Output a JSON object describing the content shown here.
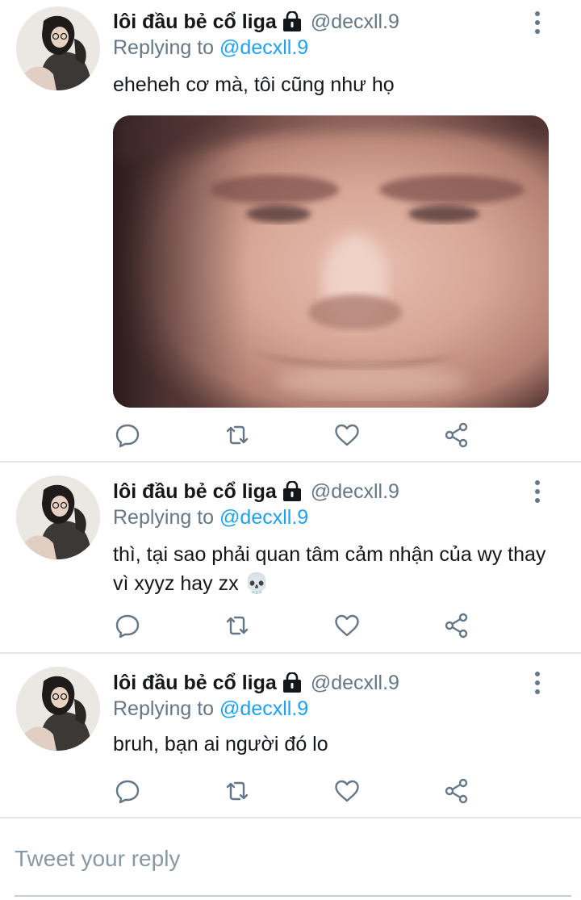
{
  "tweets": [
    {
      "display_name": "lôi đầu bẻ cổ liga",
      "handle": "@decxll.9",
      "replying_prefix": "Replying to",
      "replying_handle": "@decxll.9",
      "text": "eheheh cơ mà, tôi cũng như họ",
      "has_image": true,
      "image_desc": "close-up-face-photo"
    },
    {
      "display_name": "lôi đầu bẻ cổ liga",
      "handle": "@decxll.9",
      "replying_prefix": "Replying to",
      "replying_handle": "@decxll.9",
      "text": "thì, tại sao phải quan tâm cảm nhận của wy thay vì xyyz hay zx 💀",
      "has_image": false
    },
    {
      "display_name": "lôi đầu bẻ cổ liga",
      "handle": "@decxll.9",
      "replying_prefix": "Replying to",
      "replying_handle": "@decxll.9",
      "text": "bruh, bạn ai người đó lo",
      "has_image": false
    }
  ],
  "actions": [
    "reply-icon",
    "retweet-icon",
    "like-icon",
    "share-icon"
  ],
  "reply_box": {
    "placeholder": "Tweet your reply"
  },
  "colors": {
    "text": "#14171a",
    "secondary": "#657786",
    "mention": "#1da1f2",
    "divider": "#e1e8ed",
    "icon": "#657786"
  }
}
